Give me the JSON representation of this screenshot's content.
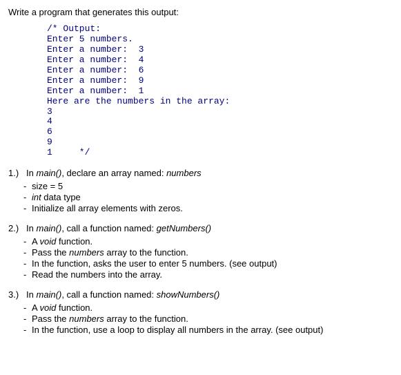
{
  "intro": {
    "prefix": "Write a  program that generates this output:"
  },
  "output_block": "/* Output:\nEnter 5 numbers.\nEnter a number:  3\nEnter a number:  4\nEnter a number:  6\nEnter a number:  9\nEnter a number:  1\nHere are the numbers in the array:\n3\n4\n6\n9\n1     */",
  "s1": {
    "num": "1.)",
    "pre": "In ",
    "main": "main()",
    "mid": ", declare an array named:   ",
    "name": "numbers",
    "bullets": {
      "b0": "size = 5",
      "b1_i": "int",
      "b1_t": " data type",
      "b2": "Initialize all array elements with zeros."
    }
  },
  "s2": {
    "num": "2.)",
    "pre": "In ",
    "main": "main()",
    "mid": ", call a function named:   ",
    "name": "getNumbers()",
    "bullets": {
      "b0_a": "A ",
      "b0_v": "void",
      "b0_b": " function.",
      "b1_a": "Pass the ",
      "b1_n": "numbers",
      "b1_b": " array to the function.",
      "b2": "In the function, asks the user to enter 5 numbers.   (see output)",
      "b3": "Read the numbers into the array."
    }
  },
  "s3": {
    "num": "3.)",
    "pre": "In ",
    "main": "main()",
    "mid": ", call a function named:   ",
    "name": "showNumbers()",
    "bullets": {
      "b0_a": "A ",
      "b0_v": "void",
      "b0_b": " function.",
      "b1_a": "Pass the ",
      "b1_n": "numbers",
      "b1_b": " array to the function.",
      "b2": "In the function, use a loop to display all numbers in the array.   (see output)"
    }
  }
}
